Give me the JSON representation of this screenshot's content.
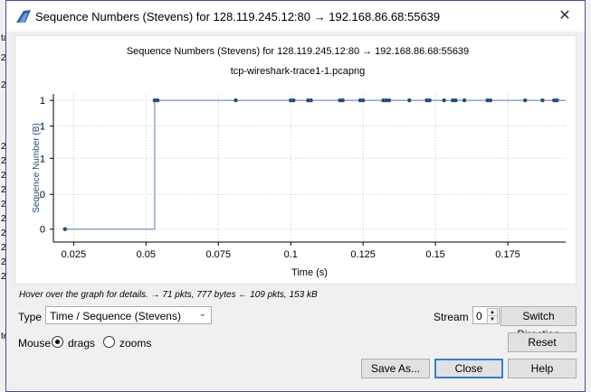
{
  "window": {
    "title": "Sequence Numbers (Stevens) for 128.119.245.12:80 → 192.168.86.68:55639",
    "close_glyph": "✕"
  },
  "background": {
    "left_rows": [
      "ta",
      "2",
      "2",
      "2",
      "2",
      "2",
      "2",
      "2",
      "2",
      "2",
      "2",
      "2",
      "2",
      "te"
    ]
  },
  "chart_data": {
    "type": "scatter",
    "title": "Sequence Numbers (Stevens) for 128.119.245.12:80 → 192.168.86.68:55639",
    "subtitle": "tcp-wireshark-trace1-1.pcapng",
    "xlabel": "Time (s)",
    "ylabel": "Sequence Number (B)",
    "x_ticks": [
      "0.025",
      "0.05",
      "0.075",
      "0.1",
      "0.125",
      "0.15",
      "0.175"
    ],
    "x_tick_values": [
      0.025,
      0.05,
      0.075,
      0.1,
      0.125,
      0.15,
      0.175
    ],
    "y_ticks": [
      "0",
      "0",
      "1",
      "1",
      "1"
    ],
    "xlim": [
      0.018,
      0.195
    ],
    "ylim": [
      -0.1,
      1.05
    ],
    "grid": true,
    "line_color": "#5b7fa6",
    "point_color": "#1f4e79",
    "series": [
      {
        "x": [
          0.022,
          0.053,
          0.054,
          0.081,
          0.1,
          0.101,
          0.106,
          0.107,
          0.117,
          0.118,
          0.124,
          0.125,
          0.132,
          0.133,
          0.134,
          0.141,
          0.147,
          0.148,
          0.153,
          0.156,
          0.157,
          0.16,
          0.168,
          0.169,
          0.181,
          0.187,
          0.191,
          0.192
        ],
        "y": [
          0,
          1,
          1,
          1,
          1,
          1,
          1,
          1,
          1,
          1,
          1,
          1,
          1,
          1,
          1,
          1,
          1,
          1,
          1,
          1,
          1,
          1,
          1,
          1,
          1,
          1,
          1,
          1
        ]
      }
    ]
  },
  "hint": "Hover over the graph for details. → 71 pkts, 777 bytes ← 109 pkts, 153 kB",
  "controls": {
    "type_label": "Type",
    "type_value": "Time / Sequence (Stevens)",
    "stream_label": "Stream",
    "stream_value": "0",
    "switch_direction": "Switch Direction",
    "mouse_label": "Mouse",
    "drags_label": "drags",
    "zooms_label": "zooms",
    "reset": "Reset",
    "save_as": "Save As...",
    "close": "Close",
    "help": "Help"
  },
  "colors": {
    "accent": "#3a7bd5",
    "title_icon": "#2e5aa8"
  }
}
